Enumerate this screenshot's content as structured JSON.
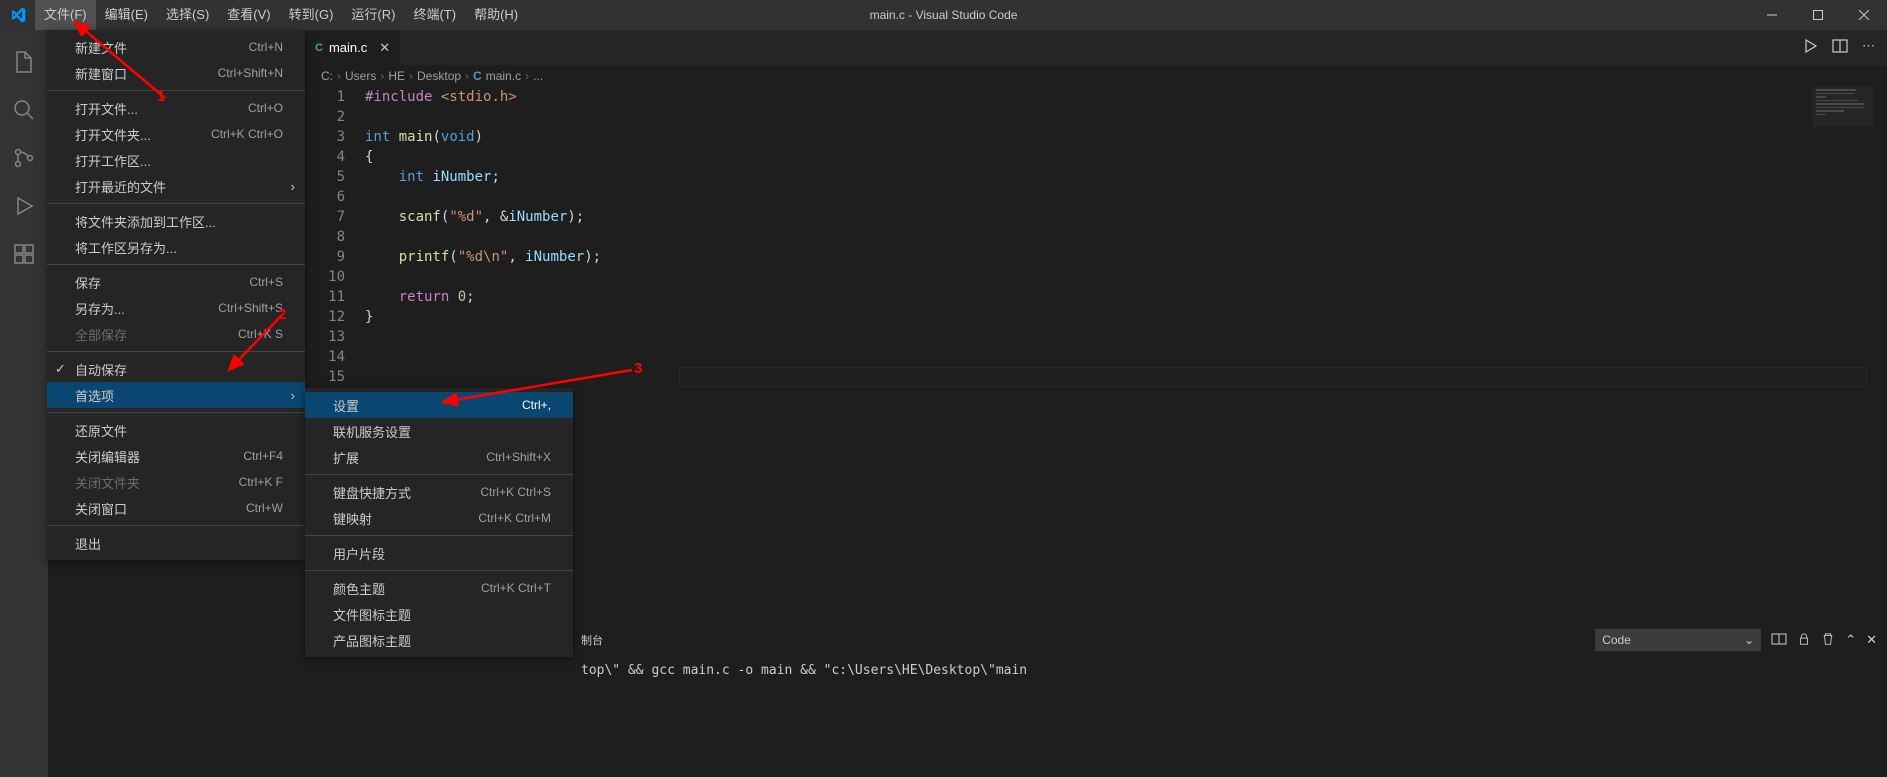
{
  "window": {
    "title": "main.c - Visual Studio Code"
  },
  "menubar": [
    "文件(F)",
    "编辑(E)",
    "选择(S)",
    "查看(V)",
    "转到(G)",
    "运行(R)",
    "终端(T)",
    "帮助(H)"
  ],
  "file_menu": {
    "groups": [
      [
        {
          "label": "新建文件",
          "shortcut": "Ctrl+N"
        },
        {
          "label": "新建窗口",
          "shortcut": "Ctrl+Shift+N"
        }
      ],
      [
        {
          "label": "打开文件...",
          "shortcut": "Ctrl+O"
        },
        {
          "label": "打开文件夹...",
          "shortcut": "Ctrl+K Ctrl+O"
        },
        {
          "label": "打开工作区..."
        },
        {
          "label": "打开最近的文件",
          "submenu": true
        }
      ],
      [
        {
          "label": "将文件夹添加到工作区..."
        },
        {
          "label": "将工作区另存为..."
        }
      ],
      [
        {
          "label": "保存",
          "shortcut": "Ctrl+S"
        },
        {
          "label": "另存为...",
          "shortcut": "Ctrl+Shift+S"
        },
        {
          "label": "全部保存",
          "shortcut": "Ctrl+K S",
          "disabled": true
        }
      ],
      [
        {
          "label": "自动保存",
          "checked": true
        },
        {
          "label": "首选项",
          "submenu": true,
          "highlighted": true
        }
      ],
      [
        {
          "label": "还原文件"
        },
        {
          "label": "关闭编辑器",
          "shortcut": "Ctrl+F4"
        },
        {
          "label": "关闭文件夹",
          "shortcut": "Ctrl+K F",
          "disabled": true
        },
        {
          "label": "关闭窗口",
          "shortcut": "Ctrl+W"
        }
      ],
      [
        {
          "label": "退出"
        }
      ]
    ]
  },
  "pref_submenu": {
    "groups": [
      [
        {
          "label": "设置",
          "shortcut": "Ctrl+,",
          "highlighted": true
        },
        {
          "label": "联机服务设置"
        },
        {
          "label": "扩展",
          "shortcut": "Ctrl+Shift+X"
        }
      ],
      [
        {
          "label": "键盘快捷方式",
          "shortcut": "Ctrl+K Ctrl+S"
        },
        {
          "label": "键映射",
          "shortcut": "Ctrl+K Ctrl+M"
        }
      ],
      [
        {
          "label": "用户片段"
        }
      ],
      [
        {
          "label": "颜色主题",
          "shortcut": "Ctrl+K Ctrl+T"
        },
        {
          "label": "文件图标主题"
        },
        {
          "label": "产品图标主题"
        }
      ]
    ]
  },
  "tab": {
    "name": "main.c",
    "lang_badge": "C"
  },
  "breadcrumb": [
    "C:",
    "Users",
    "HE",
    "Desktop",
    "main.c",
    "..."
  ],
  "code": {
    "lines": [
      {
        "n": 1,
        "tokens": [
          [
            "tk-pre",
            "#include"
          ],
          [
            "tk-plain",
            " "
          ],
          [
            "tk-str",
            "<stdio.h>"
          ]
        ]
      },
      {
        "n": 2,
        "tokens": []
      },
      {
        "n": 3,
        "tokens": [
          [
            "tk-kw",
            "int"
          ],
          [
            "tk-plain",
            " "
          ],
          [
            "tk-fn",
            "main"
          ],
          [
            "tk-plain",
            "("
          ],
          [
            "tk-kw",
            "void"
          ],
          [
            "tk-plain",
            ")"
          ]
        ]
      },
      {
        "n": 4,
        "tokens": [
          [
            "tk-plain",
            "{"
          ]
        ]
      },
      {
        "n": 5,
        "tokens": [
          [
            "tk-plain",
            "    "
          ],
          [
            "tk-kw",
            "int"
          ],
          [
            "tk-plain",
            " "
          ],
          [
            "tk-var",
            "iNumber"
          ],
          [
            "tk-plain",
            ";"
          ]
        ]
      },
      {
        "n": 6,
        "tokens": []
      },
      {
        "n": 7,
        "tokens": [
          [
            "tk-plain",
            "    "
          ],
          [
            "tk-fn",
            "scanf"
          ],
          [
            "tk-plain",
            "("
          ],
          [
            "tk-str",
            "\"%d\""
          ],
          [
            "tk-plain",
            ", &"
          ],
          [
            "tk-var",
            "iNumber"
          ],
          [
            "tk-plain",
            ");"
          ]
        ]
      },
      {
        "n": 8,
        "tokens": []
      },
      {
        "n": 9,
        "tokens": [
          [
            "tk-plain",
            "    "
          ],
          [
            "tk-fn",
            "printf"
          ],
          [
            "tk-plain",
            "("
          ],
          [
            "tk-str",
            "\"%d\\n\""
          ],
          [
            "tk-plain",
            ", "
          ],
          [
            "tk-var",
            "iNumber"
          ],
          [
            "tk-plain",
            ");"
          ]
        ]
      },
      {
        "n": 10,
        "tokens": []
      },
      {
        "n": 11,
        "tokens": [
          [
            "tk-plain",
            "    "
          ],
          [
            "tk-pre",
            "return"
          ],
          [
            "tk-plain",
            " "
          ],
          [
            "tk-num",
            "0"
          ],
          [
            "tk-plain",
            ";"
          ]
        ]
      },
      {
        "n": 12,
        "tokens": [
          [
            "tk-plain",
            "}"
          ]
        ]
      },
      {
        "n": 13,
        "tokens": []
      },
      {
        "n": 14,
        "tokens": []
      },
      {
        "n": 15,
        "tokens": []
      }
    ]
  },
  "panel": {
    "tabs_visible": "制台",
    "selector": "Code",
    "terminal_text": "top\\\" && gcc main.c -o main && \"c:\\Users\\HE\\Desktop\\\"main"
  },
  "annotations": {
    "1": "1",
    "2": "2",
    "3": "3"
  }
}
